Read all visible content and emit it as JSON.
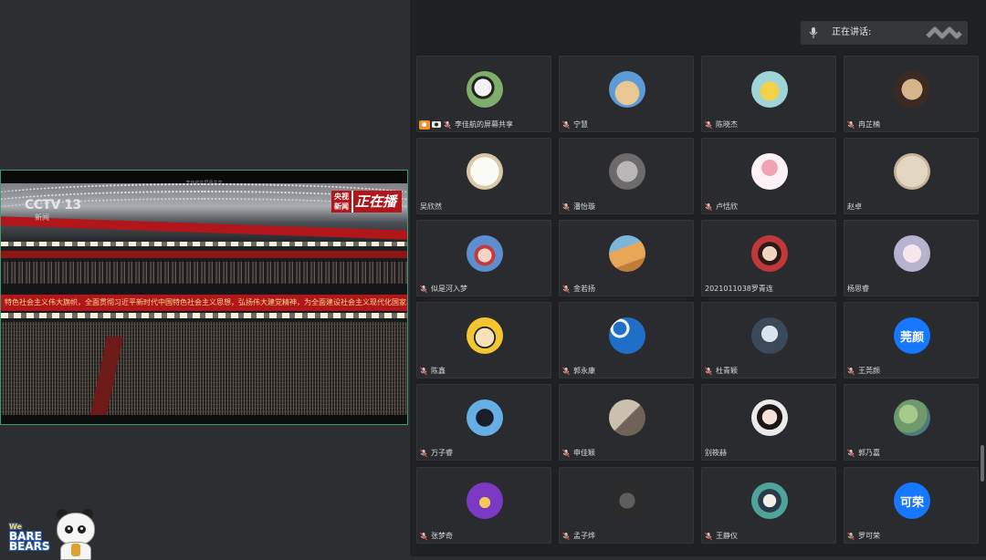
{
  "share": {
    "topbar_text": "李佳航的屏幕共享",
    "channel_logo": "CCTV 13",
    "channel_sub": "新闻",
    "live_tag_top": "央视",
    "live_tag_bottom": "新闻",
    "live_tag_main": "正在播",
    "banner_text": "特色社会主义伟大旗帜，全面贯彻习近平新时代中国特色社会主义思想，弘扬伟大建党精神，为全面建设社会主义现代化国家、全面推进中华民族伟大复兴而团结奋斗"
  },
  "mascot": {
    "line1": "We",
    "line2": "BARE",
    "line3": "BEARS"
  },
  "speaking": {
    "label": "正在讲话:"
  },
  "colors": {
    "accent_blue": "#1677ff",
    "share_border": "#3f9a6f",
    "live_red": "#b2161a"
  },
  "participants": [
    {
      "name": "李佳航的屏幕共享",
      "avatar": "panda-photo",
      "sharing": true,
      "muted": true
    },
    {
      "name": "宁慧",
      "avatar": "puppy-photo",
      "muted": true
    },
    {
      "name": "陈晓杰",
      "avatar": "duck-photo",
      "muted": true
    },
    {
      "name": "冉芷楠",
      "avatar": "cat-photo",
      "muted": true
    },
    {
      "name": "吴欣然",
      "avatar": "sketch-drawing",
      "muted": false
    },
    {
      "name": "潘怡璇",
      "avatar": "gray-cat-photo",
      "muted": true
    },
    {
      "name": "卢恬欣",
      "avatar": "pink-flower-logo",
      "muted": true
    },
    {
      "name": "赵卓",
      "avatar": "beige-stamp",
      "muted": false
    },
    {
      "name": "似是河入梦",
      "avatar": "anime-boy",
      "muted": true
    },
    {
      "name": "金若扬",
      "avatar": "orange-landscape",
      "muted": true
    },
    {
      "name": "2021011038罗青连",
      "avatar": "girl-photo",
      "muted": false
    },
    {
      "name": "杨思睿",
      "avatar": "anime-girl",
      "muted": false
    },
    {
      "name": "陈鑫",
      "avatar": "cartoon-glasses",
      "muted": true
    },
    {
      "name": "郭永康",
      "avatar": "doraemon-pattern",
      "muted": true
    },
    {
      "name": "杜青颖",
      "avatar": "dark-figure",
      "muted": true
    },
    {
      "name": "王莞颜",
      "avatar_text": "莞颜",
      "muted": true
    },
    {
      "name": "万子睿",
      "avatar": "blue-character",
      "muted": true
    },
    {
      "name": "申佳颖",
      "avatar": "sepia-photo",
      "muted": true
    },
    {
      "name": "别筱赫",
      "avatar": "woman-portrait",
      "muted": false
    },
    {
      "name": "郭乃嘉",
      "avatar": "green-texture",
      "muted": true
    },
    {
      "name": "张梦奇",
      "avatar": "purple-creature",
      "muted": true
    },
    {
      "name": "孟子烨",
      "avatar": "dark-photo",
      "muted": true
    },
    {
      "name": "王静仪",
      "avatar": "anime-teal",
      "muted": true
    },
    {
      "name": "罗可荣",
      "avatar_text": "可荣",
      "muted": true
    }
  ]
}
